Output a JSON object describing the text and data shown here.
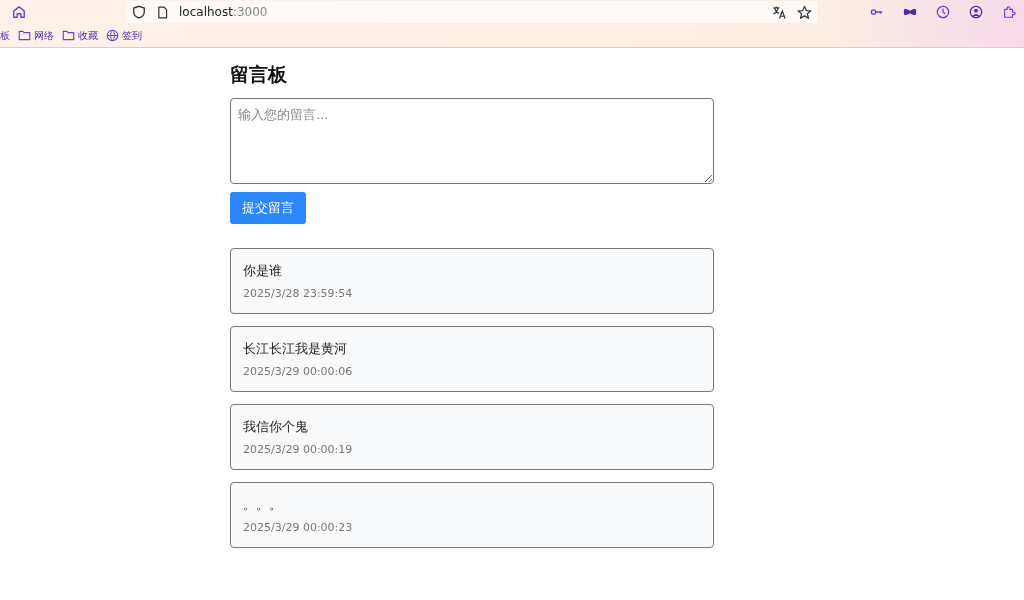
{
  "browser": {
    "url_host": "localhost",
    "url_port": ":3000",
    "bookmarks": [
      {
        "label": "板",
        "kind": "cut"
      },
      {
        "label": "网络",
        "kind": "folder"
      },
      {
        "label": "收藏",
        "kind": "folder"
      },
      {
        "label": "签到",
        "kind": "globe"
      }
    ]
  },
  "page": {
    "title": "留言板",
    "placeholder": "输入您的留言...",
    "submit": "提交留言",
    "messages": [
      {
        "text": "你是谁",
        "time": "2025/3/28 23:59:54"
      },
      {
        "text": "长江长江我是黄河",
        "time": "2025/3/29 00:00:06"
      },
      {
        "text": "我信你个鬼",
        "time": "2025/3/29 00:00:19"
      },
      {
        "text": "。。。",
        "time": "2025/3/29 00:00:23"
      }
    ]
  }
}
